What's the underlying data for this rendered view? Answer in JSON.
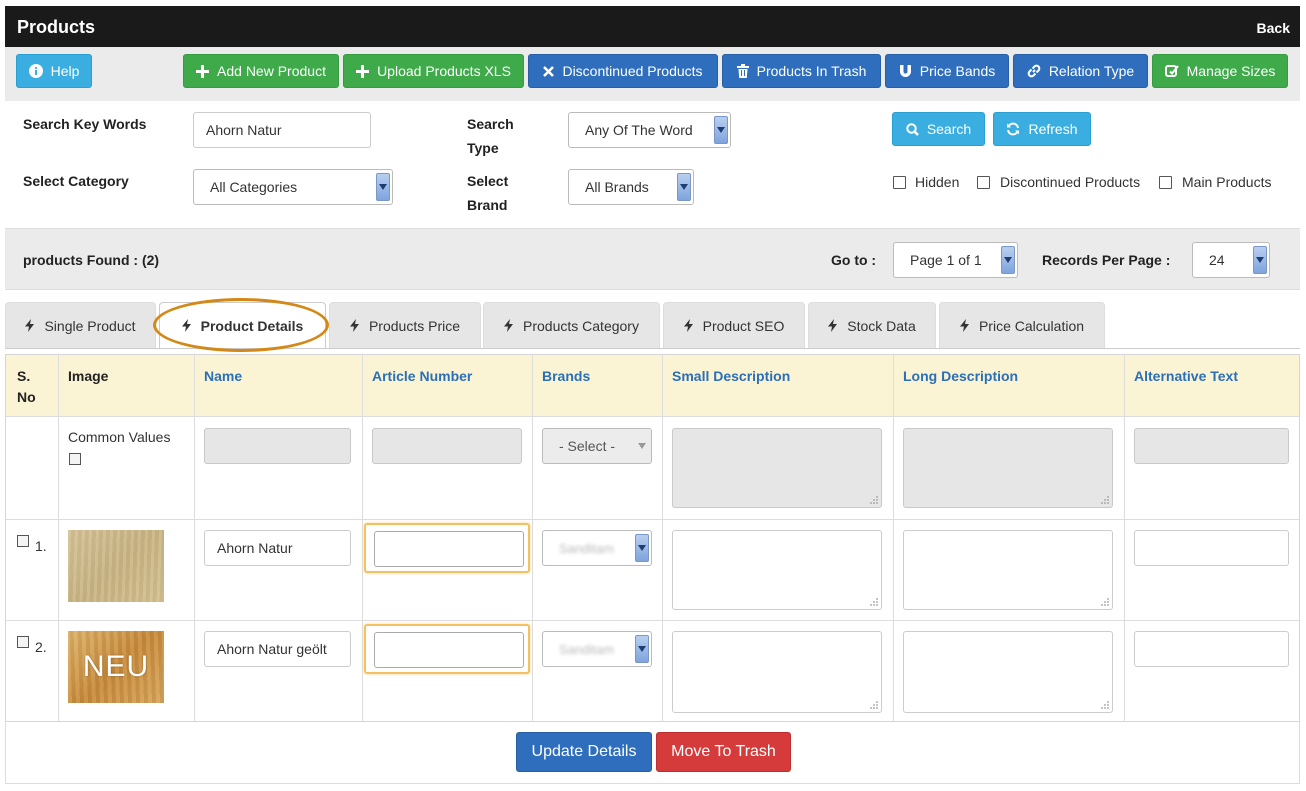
{
  "header": {
    "title": "Products",
    "back_label": "Back"
  },
  "toolbar": {
    "help": "Help",
    "add_new": "Add New Product",
    "upload_xls": "Upload Products XLS",
    "discontinued": "Discontinued Products",
    "trash": "Products In Trash",
    "price_bands": "Price Bands",
    "relation_type": "Relation Type",
    "manage_sizes": "Manage Sizes"
  },
  "search": {
    "keywords_label": "Search Key Words",
    "keywords_value": "Ahorn Natur",
    "type_label_1": "Search",
    "type_label_2": "Type",
    "type_value": "Any Of The Word",
    "category_label": "Select Category",
    "category_value": "All Categories",
    "brand_label_1": "Select",
    "brand_label_2": "Brand",
    "brand_value": "All Brands",
    "search_btn": "Search",
    "refresh_btn": "Refresh",
    "filters": {
      "hidden": "Hidden",
      "discontinued": "Discontinued Products",
      "main": "Main Products"
    }
  },
  "records": {
    "found_text": "products Found : (2)",
    "goto_label": "Go to :",
    "goto_value": "Page 1 of 1",
    "per_page_label": "Records Per Page :",
    "per_page_value": "24"
  },
  "tabs": [
    "Single Product",
    "Product Details",
    "Products Price",
    "Products Category",
    "Product SEO",
    "Stock Data",
    "Price Calculation"
  ],
  "table": {
    "headers": {
      "sno_1": "S.",
      "sno_2": "No",
      "image": "Image",
      "name": "Name",
      "article": "Article Number",
      "brands": "Brands",
      "small_desc": "Small Description",
      "long_desc": "Long Description",
      "alt_text": "Alternative Text"
    },
    "common": {
      "label": "Common Values",
      "brand_select": "- Select -"
    },
    "rows": [
      {
        "num": "1.",
        "name": "Ahorn Natur",
        "brand": "Sanditam",
        "thumb_text": ""
      },
      {
        "num": "2.",
        "name": "Ahorn Natur geölt",
        "brand": "Sanditam",
        "thumb_text": "NEU"
      }
    ]
  },
  "footer": {
    "update": "Update Details",
    "trash": "Move To Trash"
  },
  "colors": {
    "info": "#3aaee0",
    "success": "#3eaa4a",
    "primary": "#2f6ebd",
    "danger": "#d63b3b",
    "header_bg": "#fbf4d4",
    "link": "#2a6fb8",
    "highlight": "#d48817"
  }
}
